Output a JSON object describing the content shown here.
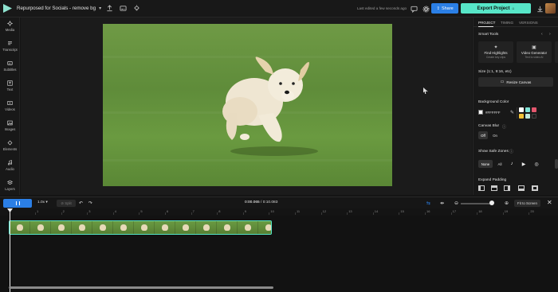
{
  "topbar": {
    "project_title": "Repurposed for Socials - remove bg",
    "save_status": "Last edited a few seconds ago",
    "share_label": "Share",
    "export_label": "Export Project"
  },
  "sidebar": {
    "items": [
      {
        "label": "Media",
        "icon": "media-icon"
      },
      {
        "label": "Transcript",
        "icon": "transcript-icon"
      },
      {
        "label": "Subtitles",
        "icon": "subtitles-icon"
      },
      {
        "label": "Text",
        "icon": "text-icon"
      },
      {
        "label": "Videos",
        "icon": "videos-icon"
      },
      {
        "label": "Images",
        "icon": "images-icon"
      },
      {
        "label": "Elements",
        "icon": "elements-icon"
      },
      {
        "label": "Audio",
        "icon": "audio-icon"
      },
      {
        "label": "Layers",
        "icon": "layers-icon"
      }
    ]
  },
  "right_panel": {
    "tabs": [
      "PROJECT",
      "TIMING",
      "VERSIONS"
    ],
    "smart_tools_label": "Smart Tools",
    "cards": [
      {
        "title": "Find Highlights",
        "subtitle": "Create key clips"
      },
      {
        "title": "Video Generator",
        "subtitle": "Text to video AI"
      }
    ],
    "size_label": "Size (1:1, 9:16, etc)",
    "resize_label": "Resize Canvas",
    "bg_color_label": "Background Color",
    "hex_value": "#FFFFFF",
    "swatches": [
      "#ffffff",
      "#7fe3d6",
      "#e4576e",
      "#f3c237",
      "#bfe9dd",
      "#1e1e1e"
    ],
    "blur_label": "Canvas Blur",
    "blur_options": [
      "Off",
      "On"
    ],
    "safe_zones_label": "Show Safe Zones",
    "safe_zone_options": [
      "None",
      "All"
    ],
    "expand_padding_label": "Expand Padding"
  },
  "controls": {
    "speed": "1.0x",
    "split_label": "Split",
    "current_time": "0:00.065",
    "total_time": "0:10.083",
    "fit_label": "Fit to Screen"
  },
  "ruler": {
    "ticks": [
      "1",
      "2",
      "3",
      "4",
      "5",
      "6",
      "7",
      "8",
      "9",
      "10",
      "11",
      "12",
      "13",
      "14",
      "15",
      "16",
      "17",
      "18",
      "19",
      "20"
    ]
  },
  "colors": {
    "accent": "#2b7fe6",
    "export": "#57e6c8",
    "clip_border": "#57e6c8"
  }
}
